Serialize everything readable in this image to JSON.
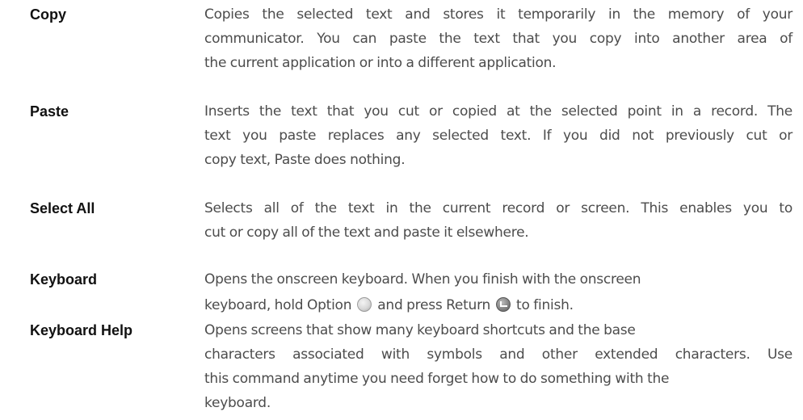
{
  "entries": [
    {
      "term": "Copy",
      "lines": [
        "Copies the selected text and stores it temporarily in the memory of your",
        "communicator. You can paste the text that you copy into another area of",
        "the current application or into a different application."
      ]
    },
    {
      "term": "Paste",
      "lines": [
        "Inserts the text that you cut or copied at the selected point in a record. The",
        "text you paste replaces any selected text. If you did not previously cut or",
        "copy text, Paste does nothing."
      ]
    },
    {
      "term": "Select All",
      "lines": [
        "Selects all of the text in the current record or screen. This enables you to",
        "cut or copy all of the text and paste it elsewhere."
      ]
    },
    {
      "term": "Keyboard",
      "line1": "Opens the onscreen keyboard. When you finish with the onscreen",
      "line2_a": "keyboard, hold Option",
      "line2_b": "and press Return",
      "line2_c": "to finish.",
      "icons": [
        "option-key-icon",
        "return-key-icon"
      ]
    },
    {
      "term": "Keyboard Help",
      "lines": [
        "Opens screens that show many keyboard shortcuts and the base",
        "characters associated with symbols and other extended characters. Use",
        "this command anytime you need forget how to do something with the",
        "keyboard."
      ]
    }
  ]
}
